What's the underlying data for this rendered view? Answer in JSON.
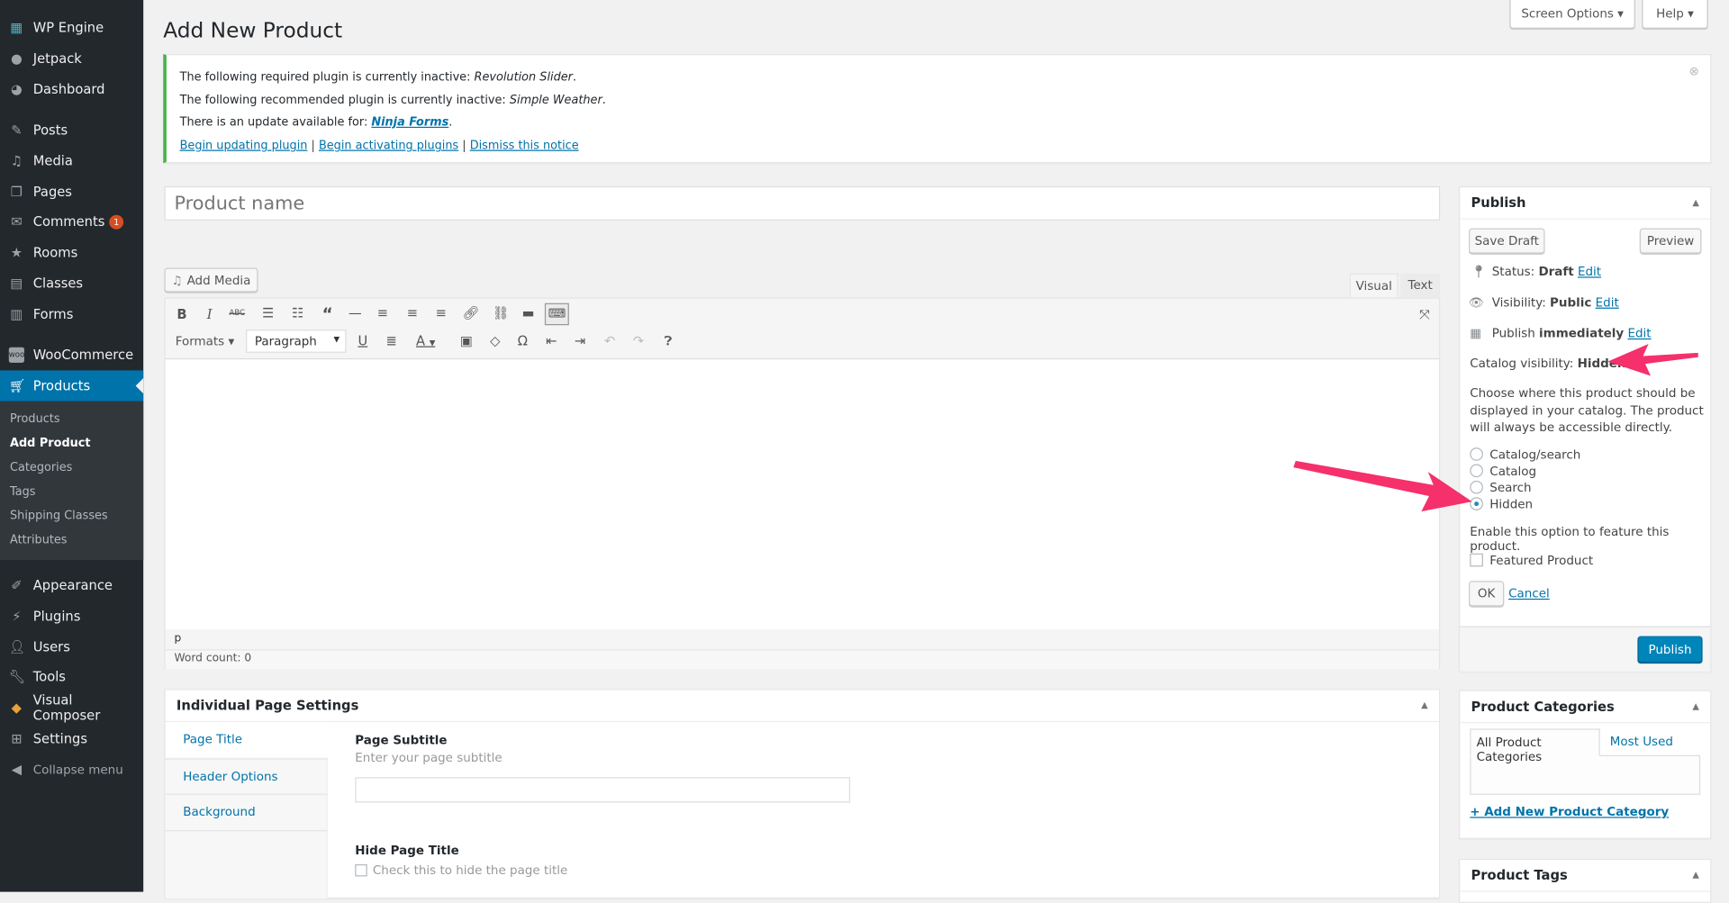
{
  "sidebar": {
    "items": [
      {
        "label": "WP Engine",
        "icon": "wp-engine-icon"
      },
      {
        "label": "Jetpack",
        "icon": "jetpack-icon"
      },
      {
        "label": "Dashboard",
        "icon": "dashboard-icon"
      },
      {
        "label": "Posts",
        "icon": "pin-icon"
      },
      {
        "label": "Media",
        "icon": "media-icon"
      },
      {
        "label": "Pages",
        "icon": "pages-icon"
      },
      {
        "label": "Comments",
        "icon": "comments-icon",
        "badge": "1"
      },
      {
        "label": "Rooms",
        "icon": "star-icon"
      },
      {
        "label": "Classes",
        "icon": "calendar-icon"
      },
      {
        "label": "Forms",
        "icon": "forms-icon"
      },
      {
        "label": "WooCommerce",
        "icon": "woo-icon"
      },
      {
        "label": "Products",
        "icon": "cart-icon"
      },
      {
        "label": "Appearance",
        "icon": "brush-icon"
      },
      {
        "label": "Plugins",
        "icon": "plug-icon"
      },
      {
        "label": "Users",
        "icon": "user-icon"
      },
      {
        "label": "Tools",
        "icon": "wrench-icon"
      },
      {
        "label": "Visual Composer",
        "icon": "vc-icon"
      },
      {
        "label": "Settings",
        "icon": "settings-icon"
      }
    ],
    "submenu": [
      "Products",
      "Add Product",
      "Categories",
      "Tags",
      "Shipping Classes",
      "Attributes"
    ],
    "collapse": "Collapse menu"
  },
  "topbar": {
    "screen_options": "Screen Options ▾",
    "help": "Help ▾"
  },
  "page": {
    "title": "Add New Product"
  },
  "notice": {
    "line1": "The following required plugin is currently inactive: ",
    "line1_em": "Revolution Slider",
    "line2": "The following recommended plugin is currently inactive: ",
    "line2_em": "Simple Weather",
    "line3": "There is an update available for: ",
    "line3_link": "Ninja Forms",
    "link1": "Begin updating plugin",
    "link2": "Begin activating plugins",
    "link3": "Dismiss this notice",
    "sep": "|"
  },
  "editor": {
    "title_placeholder": "Product name",
    "add_media": "Add Media",
    "tab_visual": "Visual",
    "tab_text": "Text",
    "formats": "Formats ▾",
    "paragraph": "Paragraph",
    "path": "p",
    "word_count": "Word count: 0"
  },
  "page_settings": {
    "title": "Individual Page Settings",
    "tabs": [
      "Page Title",
      "Header Options",
      "Background"
    ],
    "subtitle_label": "Page Subtitle",
    "subtitle_help": "Enter your page subtitle",
    "subtitle_value": "",
    "hide_label": "Hide Page Title",
    "hide_help": "Check this to hide the page title"
  },
  "publish": {
    "title": "Publish",
    "save_draft": "Save Draft",
    "preview": "Preview",
    "status_label": "Status: ",
    "status_value": "Draft",
    "visibility_label": "Visibility: ",
    "visibility_value": "Public",
    "publish_label": "Publish ",
    "publish_value": "immediately",
    "edit": "Edit",
    "catalog_label": "Catalog visibility: ",
    "catalog_value": "Hidden",
    "catalog_desc": "Choose where this product should be displayed in your catalog. The product will always be accessible directly.",
    "options": [
      "Catalog/search",
      "Catalog",
      "Search",
      "Hidden"
    ],
    "selected": "Hidden",
    "feature_desc": "Enable this option to feature this product.",
    "featured_label": "Featured Product",
    "featured_checked": false,
    "ok": "OK",
    "cancel": "Cancel",
    "publish_button": "Publish"
  },
  "categories": {
    "title": "Product Categories",
    "tab_all": "All Product Categories",
    "tab_most": "Most Used",
    "add_new": "+ Add New Product Category"
  },
  "tags": {
    "title": "Product Tags"
  },
  "colors": {
    "sidebar": "#23282d",
    "accent": "#0073aa",
    "notice_border": "#46b450",
    "annotation_arrow": "#f5306b"
  }
}
